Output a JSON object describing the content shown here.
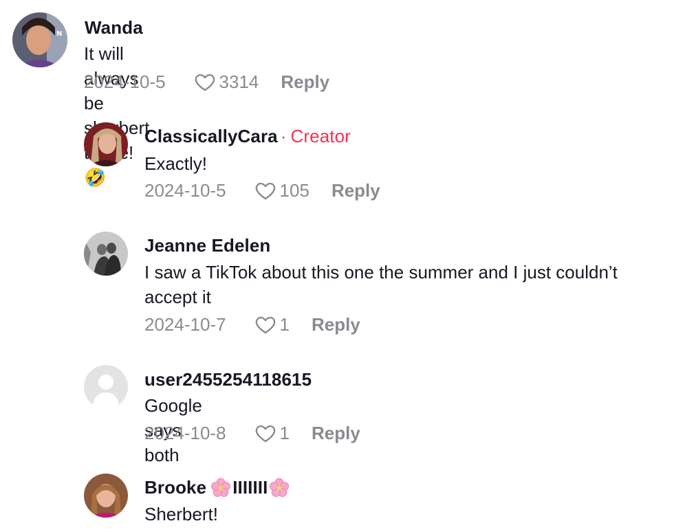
{
  "comments": [
    {
      "username": "Wanda",
      "text": "It will always be sherbert to me! 🤣",
      "date": "2024-10-5",
      "likes": "3314",
      "reply_label": "Reply"
    },
    {
      "username": "ClassicallyCara",
      "badge_separator": "·",
      "badge": "Creator",
      "text": "Exactly!",
      "date": "2024-10-5",
      "likes": "105",
      "reply_label": "Reply"
    },
    {
      "username": "Jeanne Edelen",
      "text_line1": "I saw a TikTok about this one the summer and I just couldn’t",
      "text_line2": "accept it",
      "date": "2024-10-7",
      "likes": "1",
      "reply_label": "Reply"
    },
    {
      "username": "user2455254118615",
      "text": "Google says both",
      "date": "2024-10-8",
      "likes": "1",
      "reply_label": "Reply"
    },
    {
      "username_prefix": "Brooke",
      "username_middle": "IIIIIII",
      "text": "Sherbert!"
    }
  ],
  "icons": {
    "like": "heart-outline-icon",
    "flower": "cherry-blossom-icon"
  },
  "colors": {
    "creator_badge": "#fe2c55",
    "meta_text": "#8a8b91",
    "primary_text": "#161823"
  }
}
